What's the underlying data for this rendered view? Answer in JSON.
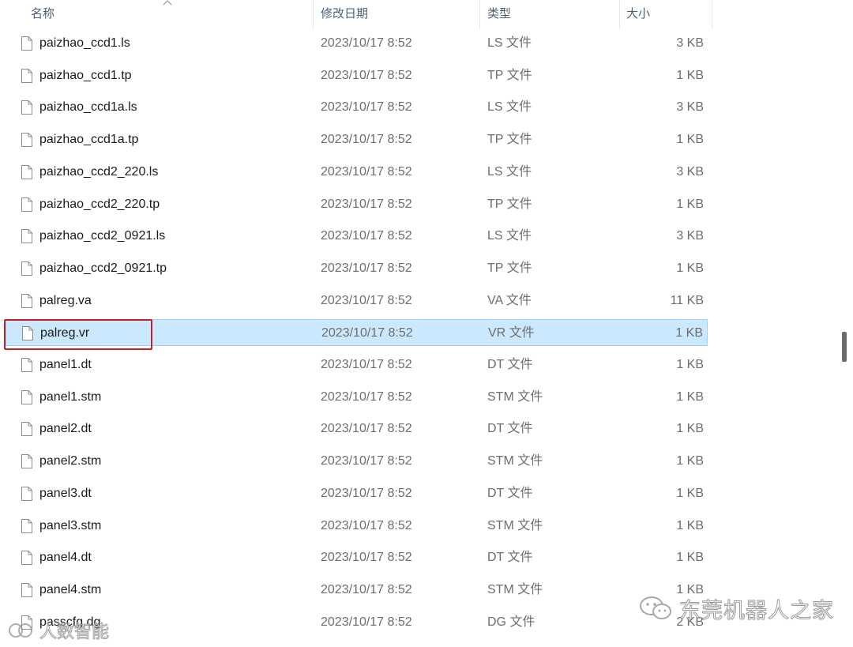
{
  "columns": {
    "name": "名称",
    "date": "修改日期",
    "type": "类型",
    "size": "大小"
  },
  "files": [
    {
      "name": "paizhao_ccd1.ls",
      "date": "2023/10/17 8:52",
      "type": "LS 文件",
      "size": "3 KB",
      "selected": false
    },
    {
      "name": "paizhao_ccd1.tp",
      "date": "2023/10/17 8:52",
      "type": "TP 文件",
      "size": "1 KB",
      "selected": false
    },
    {
      "name": "paizhao_ccd1a.ls",
      "date": "2023/10/17 8:52",
      "type": "LS 文件",
      "size": "3 KB",
      "selected": false
    },
    {
      "name": "paizhao_ccd1a.tp",
      "date": "2023/10/17 8:52",
      "type": "TP 文件",
      "size": "1 KB",
      "selected": false
    },
    {
      "name": "paizhao_ccd2_220.ls",
      "date": "2023/10/17 8:52",
      "type": "LS 文件",
      "size": "3 KB",
      "selected": false
    },
    {
      "name": "paizhao_ccd2_220.tp",
      "date": "2023/10/17 8:52",
      "type": "TP 文件",
      "size": "1 KB",
      "selected": false
    },
    {
      "name": "paizhao_ccd2_0921.ls",
      "date": "2023/10/17 8:52",
      "type": "LS 文件",
      "size": "3 KB",
      "selected": false
    },
    {
      "name": "paizhao_ccd2_0921.tp",
      "date": "2023/10/17 8:52",
      "type": "TP 文件",
      "size": "1 KB",
      "selected": false
    },
    {
      "name": "palreg.va",
      "date": "2023/10/17 8:52",
      "type": "VA 文件",
      "size": "11 KB",
      "selected": false
    },
    {
      "name": "palreg.vr",
      "date": "2023/10/17 8:52",
      "type": "VR 文件",
      "size": "1 KB",
      "selected": true
    },
    {
      "name": "panel1.dt",
      "date": "2023/10/17 8:52",
      "type": "DT 文件",
      "size": "1 KB",
      "selected": false
    },
    {
      "name": "panel1.stm",
      "date": "2023/10/17 8:52",
      "type": "STM 文件",
      "size": "1 KB",
      "selected": false
    },
    {
      "name": "panel2.dt",
      "date": "2023/10/17 8:52",
      "type": "DT 文件",
      "size": "1 KB",
      "selected": false
    },
    {
      "name": "panel2.stm",
      "date": "2023/10/17 8:52",
      "type": "STM 文件",
      "size": "1 KB",
      "selected": false
    },
    {
      "name": "panel3.dt",
      "date": "2023/10/17 8:52",
      "type": "DT 文件",
      "size": "1 KB",
      "selected": false
    },
    {
      "name": "panel3.stm",
      "date": "2023/10/17 8:52",
      "type": "STM 文件",
      "size": "1 KB",
      "selected": false
    },
    {
      "name": "panel4.dt",
      "date": "2023/10/17 8:52",
      "type": "DT 文件",
      "size": "1 KB",
      "selected": false
    },
    {
      "name": "panel4.stm",
      "date": "2023/10/17 8:52",
      "type": "STM 文件",
      "size": "1 KB",
      "selected": false
    },
    {
      "name": "passcfg.dg",
      "date": "2023/10/17 8:52",
      "type": "DG 文件",
      "size": "2 KB",
      "selected": false
    }
  ],
  "watermark": {
    "brand": "东莞机器人之家",
    "source": "人数智能"
  },
  "colors": {
    "selection_bg": "#cce8ff",
    "selection_border": "#99d1ff",
    "highlight_box": "#c7202a",
    "header_text": "#4c607a"
  },
  "icons": {
    "file": "file-icon",
    "sort": "sort-up-icon",
    "wechat": "wechat-icon"
  }
}
